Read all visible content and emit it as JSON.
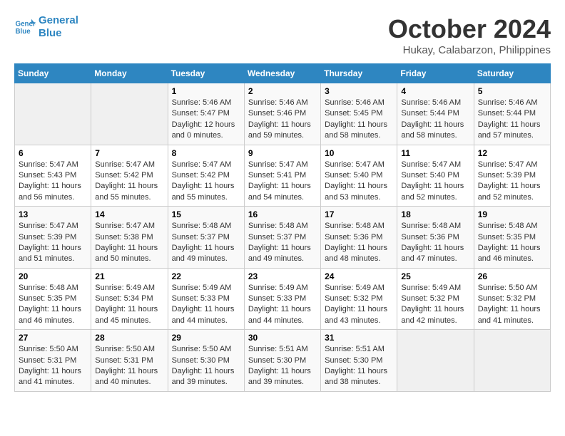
{
  "header": {
    "logo_line1": "General",
    "logo_line2": "Blue",
    "month": "October 2024",
    "location": "Hukay, Calabarzon, Philippines"
  },
  "days_of_week": [
    "Sunday",
    "Monday",
    "Tuesday",
    "Wednesday",
    "Thursday",
    "Friday",
    "Saturday"
  ],
  "weeks": [
    [
      {
        "day": "",
        "empty": true
      },
      {
        "day": "",
        "empty": true
      },
      {
        "day": "1",
        "sunrise": "5:46 AM",
        "sunset": "5:47 PM",
        "daylight": "12 hours and 0 minutes."
      },
      {
        "day": "2",
        "sunrise": "5:46 AM",
        "sunset": "5:46 PM",
        "daylight": "11 hours and 59 minutes."
      },
      {
        "day": "3",
        "sunrise": "5:46 AM",
        "sunset": "5:45 PM",
        "daylight": "11 hours and 58 minutes."
      },
      {
        "day": "4",
        "sunrise": "5:46 AM",
        "sunset": "5:44 PM",
        "daylight": "11 hours and 58 minutes."
      },
      {
        "day": "5",
        "sunrise": "5:46 AM",
        "sunset": "5:44 PM",
        "daylight": "11 hours and 57 minutes."
      }
    ],
    [
      {
        "day": "6",
        "sunrise": "5:47 AM",
        "sunset": "5:43 PM",
        "daylight": "11 hours and 56 minutes."
      },
      {
        "day": "7",
        "sunrise": "5:47 AM",
        "sunset": "5:42 PM",
        "daylight": "11 hours and 55 minutes."
      },
      {
        "day": "8",
        "sunrise": "5:47 AM",
        "sunset": "5:42 PM",
        "daylight": "11 hours and 55 minutes."
      },
      {
        "day": "9",
        "sunrise": "5:47 AM",
        "sunset": "5:41 PM",
        "daylight": "11 hours and 54 minutes."
      },
      {
        "day": "10",
        "sunrise": "5:47 AM",
        "sunset": "5:40 PM",
        "daylight": "11 hours and 53 minutes."
      },
      {
        "day": "11",
        "sunrise": "5:47 AM",
        "sunset": "5:40 PM",
        "daylight": "11 hours and 52 minutes."
      },
      {
        "day": "12",
        "sunrise": "5:47 AM",
        "sunset": "5:39 PM",
        "daylight": "11 hours and 52 minutes."
      }
    ],
    [
      {
        "day": "13",
        "sunrise": "5:47 AM",
        "sunset": "5:39 PM",
        "daylight": "11 hours and 51 minutes."
      },
      {
        "day": "14",
        "sunrise": "5:47 AM",
        "sunset": "5:38 PM",
        "daylight": "11 hours and 50 minutes."
      },
      {
        "day": "15",
        "sunrise": "5:48 AM",
        "sunset": "5:37 PM",
        "daylight": "11 hours and 49 minutes."
      },
      {
        "day": "16",
        "sunrise": "5:48 AM",
        "sunset": "5:37 PM",
        "daylight": "11 hours and 49 minutes."
      },
      {
        "day": "17",
        "sunrise": "5:48 AM",
        "sunset": "5:36 PM",
        "daylight": "11 hours and 48 minutes."
      },
      {
        "day": "18",
        "sunrise": "5:48 AM",
        "sunset": "5:36 PM",
        "daylight": "11 hours and 47 minutes."
      },
      {
        "day": "19",
        "sunrise": "5:48 AM",
        "sunset": "5:35 PM",
        "daylight": "11 hours and 46 minutes."
      }
    ],
    [
      {
        "day": "20",
        "sunrise": "5:48 AM",
        "sunset": "5:35 PM",
        "daylight": "11 hours and 46 minutes."
      },
      {
        "day": "21",
        "sunrise": "5:49 AM",
        "sunset": "5:34 PM",
        "daylight": "11 hours and 45 minutes."
      },
      {
        "day": "22",
        "sunrise": "5:49 AM",
        "sunset": "5:33 PM",
        "daylight": "11 hours and 44 minutes."
      },
      {
        "day": "23",
        "sunrise": "5:49 AM",
        "sunset": "5:33 PM",
        "daylight": "11 hours and 44 minutes."
      },
      {
        "day": "24",
        "sunrise": "5:49 AM",
        "sunset": "5:32 PM",
        "daylight": "11 hours and 43 minutes."
      },
      {
        "day": "25",
        "sunrise": "5:49 AM",
        "sunset": "5:32 PM",
        "daylight": "11 hours and 42 minutes."
      },
      {
        "day": "26",
        "sunrise": "5:50 AM",
        "sunset": "5:32 PM",
        "daylight": "11 hours and 41 minutes."
      }
    ],
    [
      {
        "day": "27",
        "sunrise": "5:50 AM",
        "sunset": "5:31 PM",
        "daylight": "11 hours and 41 minutes."
      },
      {
        "day": "28",
        "sunrise": "5:50 AM",
        "sunset": "5:31 PM",
        "daylight": "11 hours and 40 minutes."
      },
      {
        "day": "29",
        "sunrise": "5:50 AM",
        "sunset": "5:30 PM",
        "daylight": "11 hours and 39 minutes."
      },
      {
        "day": "30",
        "sunrise": "5:51 AM",
        "sunset": "5:30 PM",
        "daylight": "11 hours and 39 minutes."
      },
      {
        "day": "31",
        "sunrise": "5:51 AM",
        "sunset": "5:30 PM",
        "daylight": "11 hours and 38 minutes."
      },
      {
        "day": "",
        "empty": true
      },
      {
        "day": "",
        "empty": true
      }
    ]
  ],
  "labels": {
    "sunrise_prefix": "Sunrise: ",
    "sunset_prefix": "Sunset: ",
    "daylight_prefix": "Daylight: "
  }
}
